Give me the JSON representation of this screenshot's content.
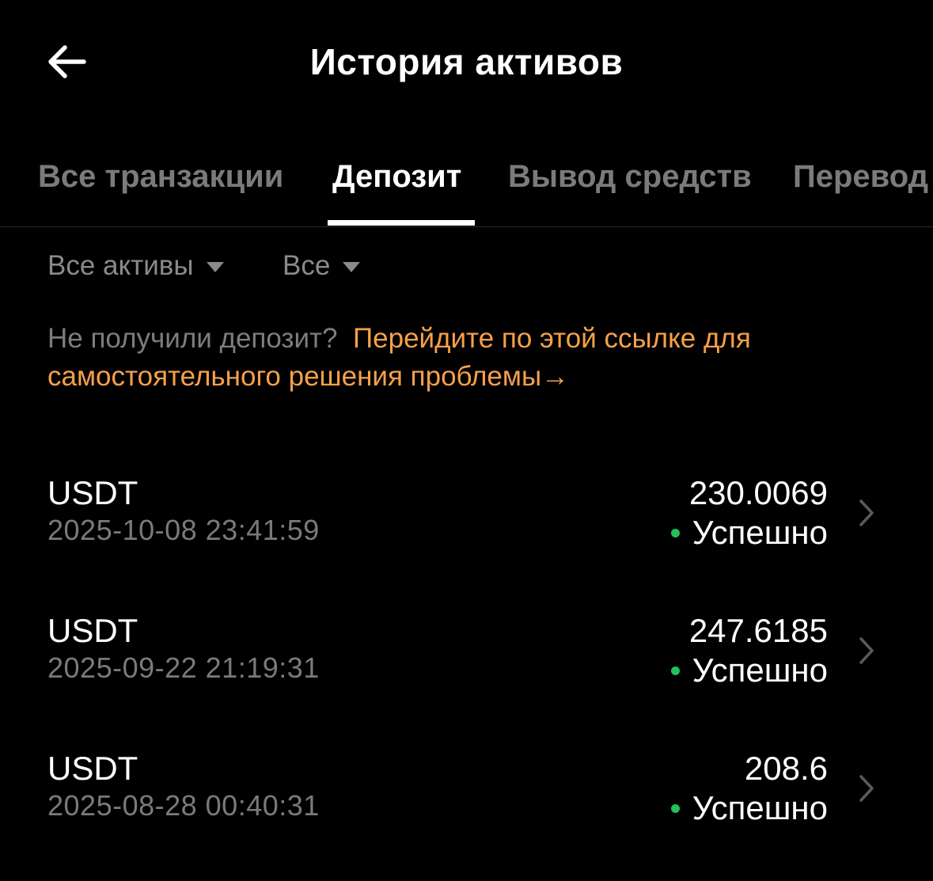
{
  "header": {
    "title": "История активов",
    "back_icon": "arrow-left-icon"
  },
  "tabs": [
    {
      "label": "Все транзакции",
      "active": false
    },
    {
      "label": "Депозит",
      "active": true
    },
    {
      "label": "Вывод средств",
      "active": false
    },
    {
      "label": "Перевод",
      "active": false
    }
  ],
  "filters": {
    "asset": "Все активы",
    "status": "Все"
  },
  "notice": {
    "text": "Не получили депозит?",
    "link": "Перейдите по этой ссылке для самостоятельного решения проблемы",
    "arrow": "→"
  },
  "transactions": [
    {
      "asset": "USDT",
      "time": "2025-10-08 23:41:59",
      "amount": "230.0069",
      "status": "Успешно"
    },
    {
      "asset": "USDT",
      "time": "2025-09-22 21:19:31",
      "amount": "247.6185",
      "status": "Успешно"
    },
    {
      "asset": "USDT",
      "time": "2025-08-28 00:40:31",
      "amount": "208.6",
      "status": "Успешно"
    }
  ],
  "colors": {
    "background": "#000000",
    "accent": "#f5a04a",
    "success": "#23c15a",
    "muted": "#7b7b7b"
  }
}
